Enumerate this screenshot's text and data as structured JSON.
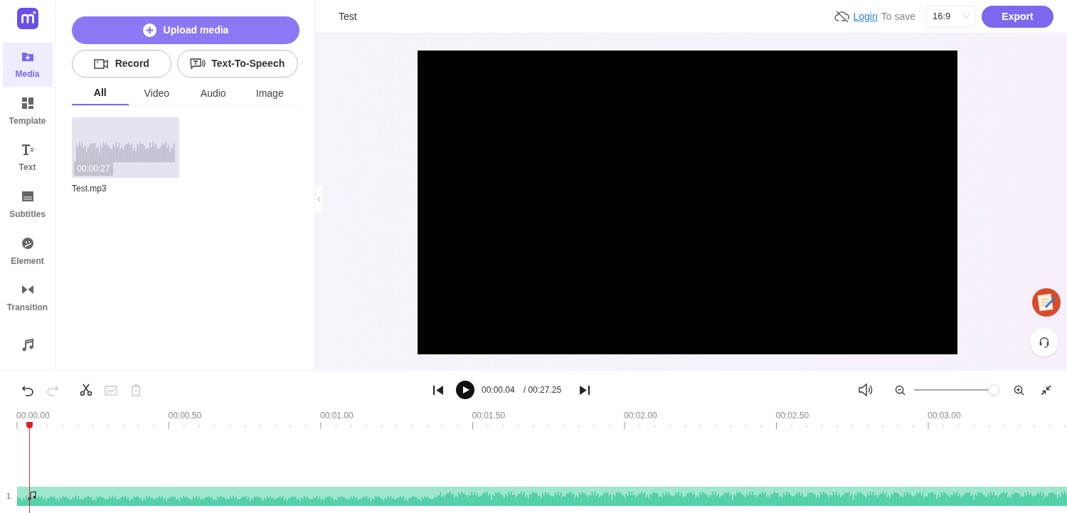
{
  "sidebar": {
    "items": [
      {
        "label": "Media",
        "selected": true
      },
      {
        "label": "Template",
        "selected": false
      },
      {
        "label": "Text",
        "selected": false
      },
      {
        "label": "Subtitles",
        "selected": false
      },
      {
        "label": "Element",
        "selected": false
      },
      {
        "label": "Transition",
        "selected": false
      },
      {
        "selected": false
      }
    ]
  },
  "panel": {
    "upload_button": "Upload media",
    "record_button": "Record",
    "tts_button": "Text-To-Speech",
    "tabs": [
      {
        "label": "All",
        "selected": true
      },
      {
        "label": "Video",
        "selected": false
      },
      {
        "label": "Audio",
        "selected": false
      },
      {
        "label": "Image",
        "selected": false
      }
    ],
    "media_items": [
      {
        "duration": "00:00:27",
        "name": "Test.mp3"
      }
    ]
  },
  "topbar": {
    "project_title": "Test",
    "login_link": "Login",
    "save_text": "To save",
    "aspect_ratio": "16:9",
    "export_button": "Export"
  },
  "timeline": {
    "tools": [
      {
        "disabled": false
      },
      {
        "disabled": true
      },
      {
        "disabled": false
      },
      {
        "disabled": true
      },
      {
        "disabled": true
      }
    ],
    "current_time": "00:00.04",
    "total_time": "/ 00:27.25",
    "zoom": {
      "level": 0.93
    },
    "ruler_labels": [
      "00:00.00",
      "00:00.50",
      "00:01.00",
      "00:01.50",
      "00:02.00",
      "00:02.50",
      "00:03.00"
    ],
    "tracks": [
      {
        "number": "1"
      }
    ]
  }
}
